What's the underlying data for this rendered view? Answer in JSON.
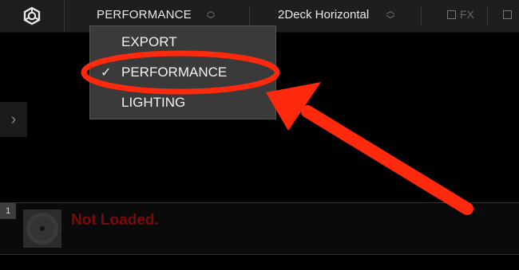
{
  "toolbar": {
    "mode_label": "PERFORMANCE",
    "layout_label": "2Deck Horizontal",
    "fx_label": "FX",
    "icons": [
      "logo-icon",
      "updown-chevron-icon",
      "checkbox-icon"
    ]
  },
  "mode_menu": {
    "items": [
      {
        "label": "EXPORT",
        "checked": false
      },
      {
        "label": "PERFORMANCE",
        "checked": true
      },
      {
        "label": "LIGHTING",
        "checked": false
      }
    ],
    "check_glyph": "✓"
  },
  "sidebar": {
    "expand_glyph": "›"
  },
  "deck": {
    "number": "1",
    "status": "Not Loaded."
  },
  "annotation": {
    "color": "#ff2a0d"
  }
}
